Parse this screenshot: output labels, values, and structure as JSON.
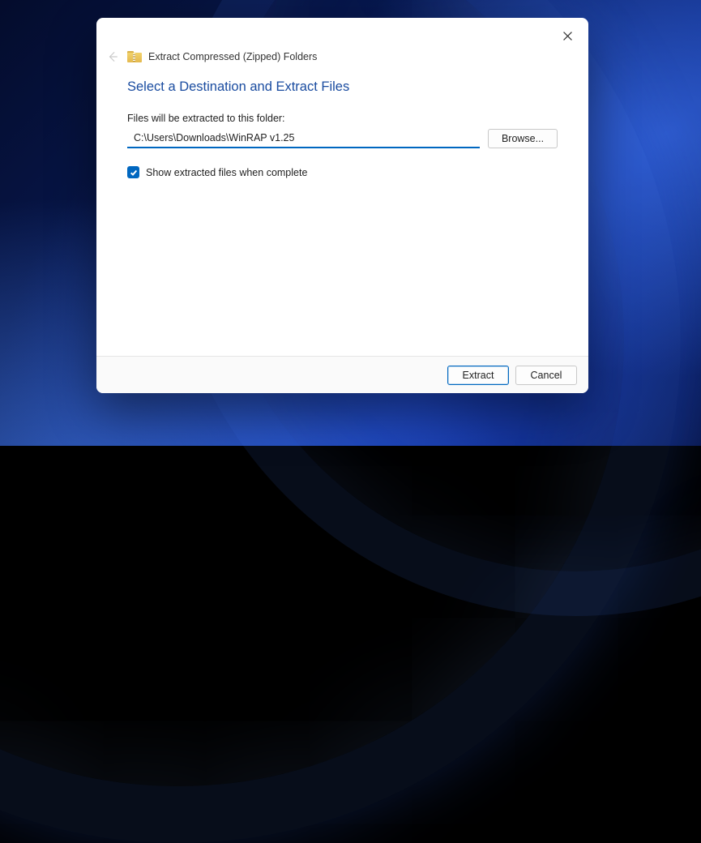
{
  "dialog": {
    "wizard_title": "Extract Compressed (Zipped) Folders",
    "heading": "Select a Destination and Extract Files",
    "field_label": "Files will be extracted to this folder:",
    "path_value": "C:\\Users\\Downloads\\WinRAP v1.25",
    "browse_label": "Browse...",
    "show_extracted_checked": true,
    "show_extracted_label": "Show extracted files when complete",
    "buttons": {
      "extract": "Extract",
      "cancel": "Cancel"
    }
  }
}
